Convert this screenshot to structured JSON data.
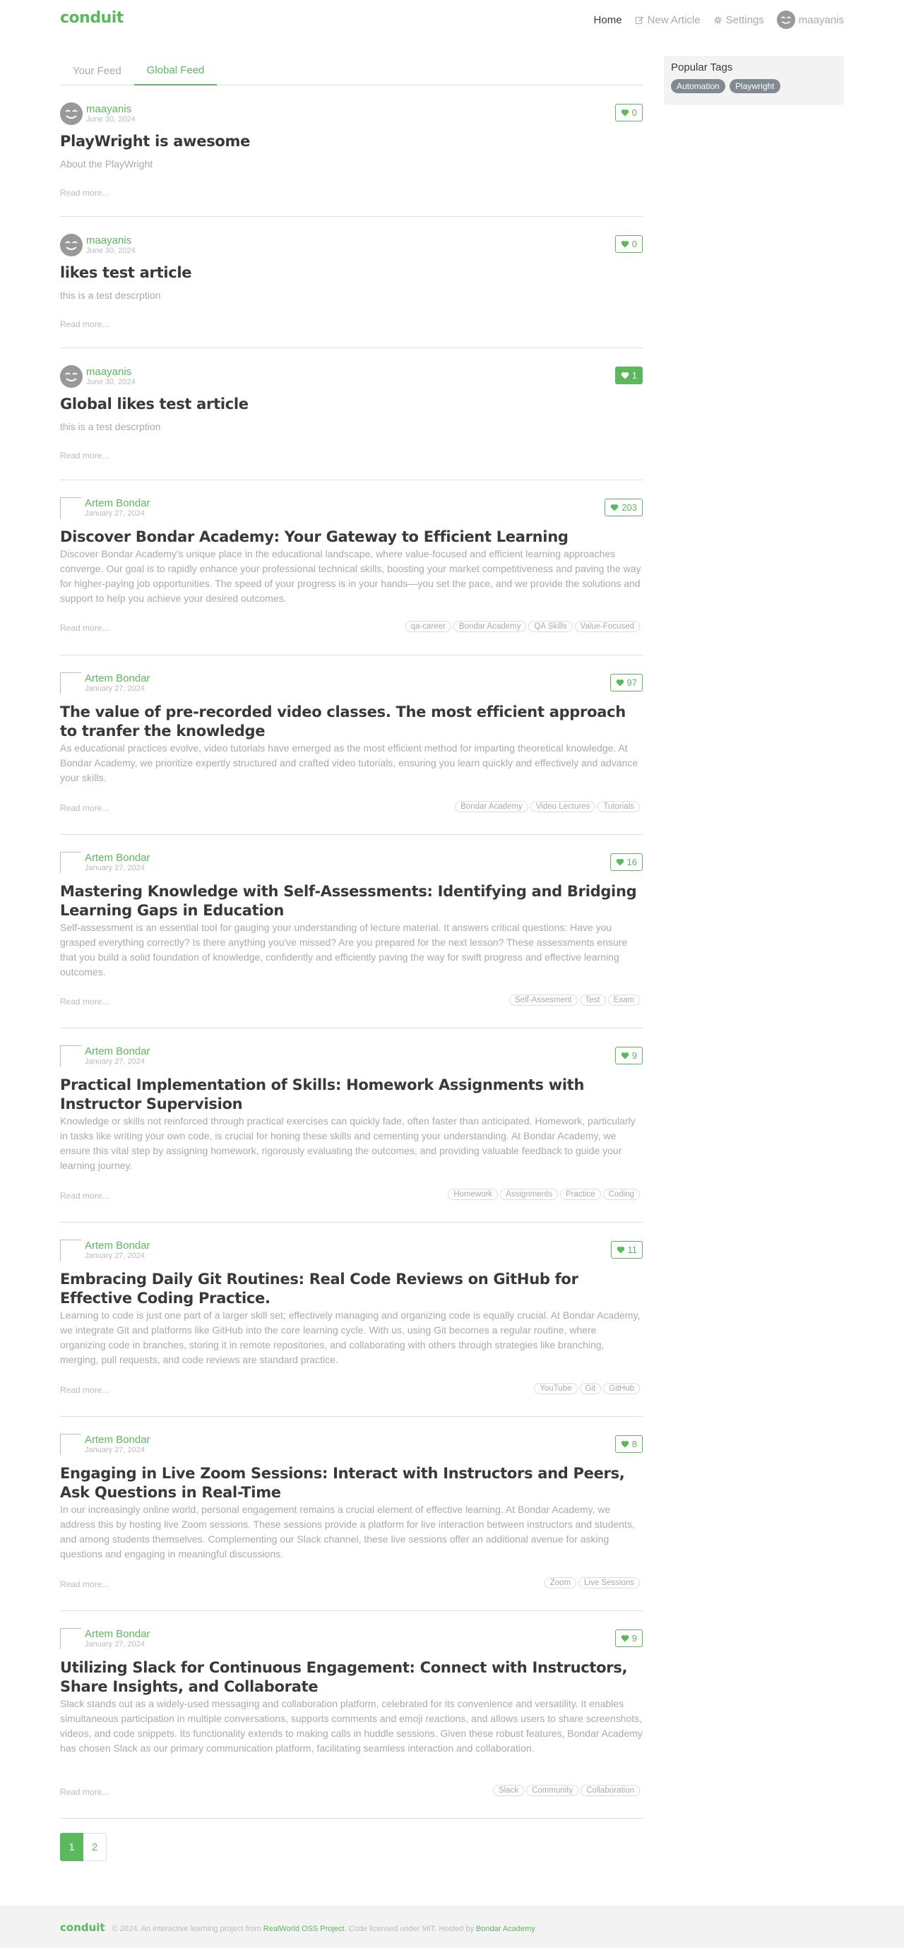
{
  "nav": {
    "brand": "conduit",
    "home": "Home",
    "new_article": "New Article",
    "settings": "Settings",
    "username": "maayanis"
  },
  "tabs": {
    "your_feed": "Your Feed",
    "global_feed": "Global Feed"
  },
  "sidebar": {
    "title": "Popular Tags",
    "tags": [
      "Automation",
      "Playwright"
    ]
  },
  "read_more": "Read more...",
  "articles": [
    {
      "author": "maayanis",
      "date": "June 30, 2024",
      "likes": "0",
      "liked": false,
      "avatar": "smiley",
      "title": "PlayWright is awesome",
      "desc": "About the PlayWright",
      "tags": []
    },
    {
      "author": "maayanis",
      "date": "June 30, 2024",
      "likes": "0",
      "liked": false,
      "avatar": "smiley",
      "title": "likes test article",
      "desc": "this is a test descrption",
      "tags": []
    },
    {
      "author": "maayanis",
      "date": "June 30, 2024",
      "likes": "1",
      "liked": true,
      "avatar": "smiley",
      "title": "Global likes test article",
      "desc": "this is a test descrption",
      "tags": []
    },
    {
      "author": "Artem Bondar",
      "date": "January 27, 2024",
      "likes": "203",
      "liked": false,
      "avatar": "broken",
      "title": "Discover Bondar Academy: Your Gateway to Efficient Learning",
      "desc": "Discover Bondar Academy's unique place in the educational landscape, where value-focused and efficient learning approaches converge. Our goal is to rapidly enhance your professional technical skills, boosting your market competitiveness and paving the way for higher-paying job opportunities. The speed of your progress is in your hands—you set the pace, and we provide the solutions and support to help you achieve your desired outcomes.",
      "tags": [
        "qa-career",
        "Bondar Academy",
        "QA Skills",
        "Value-Focused"
      ]
    },
    {
      "author": "Artem Bondar",
      "date": "January 27, 2024",
      "likes": "97",
      "liked": false,
      "avatar": "broken",
      "title": "The value of pre-recorded video classes. The most efficient approach to tranfer the knowledge",
      "desc": "As educational practices evolve, video tutorials have emerged as the most efficient method for imparting theoretical knowledge. At Bondar Academy, we prioritize expertly structured and crafted video tutorials, ensuring you learn quickly and effectively and advance your skills.",
      "tags": [
        "Bondar Academy",
        "Video Lectures",
        "Tutorials"
      ]
    },
    {
      "author": "Artem Bondar",
      "date": "January 27, 2024",
      "likes": "16",
      "liked": false,
      "avatar": "broken",
      "title": "Mastering Knowledge with Self-Assessments: Identifying and Bridging Learning Gaps in Education",
      "desc": "Self-assessment is an essential tool for gauging your understanding of lecture material. It answers critical questions: Have you grasped everything correctly? Is there anything you've missed? Are you prepared for the next lesson? These assessments ensure that you build a solid foundation of knowledge, confidently and efficiently paving the way for swift progress and effective learning outcomes.",
      "tags": [
        "Self-Assesment",
        "Test",
        "Exam"
      ]
    },
    {
      "author": "Artem Bondar",
      "date": "January 27, 2024",
      "likes": "9",
      "liked": false,
      "avatar": "broken",
      "title": "Practical Implementation of Skills: Homework Assignments with Instructor Supervision",
      "desc": "Knowledge or skills not reinforced through practical exercises can quickly fade, often faster than anticipated. Homework, particularly in tasks like writing your own code, is crucial for honing these skills and cementing your understanding. At Bondar Academy, we ensure this vital step by assigning homework, rigorously evaluating the outcomes, and providing valuable feedback to guide your learning journey.",
      "tags": [
        "Homework",
        "Assignments",
        "Practice",
        "Coding"
      ]
    },
    {
      "author": "Artem Bondar",
      "date": "January 27, 2024",
      "likes": "11",
      "liked": false,
      "avatar": "broken",
      "title": "Embracing Daily Git Routines: Real Code Reviews on GitHub for Effective Coding Practice.",
      "desc": "Learning to code is just one part of a larger skill set; effectively managing and organizing code is equally crucial. At Bondar Academy, we integrate Git and platforms like GitHub into the core learning cycle. With us, using Git becomes a regular routine, where organizing code in branches, storing it in remote repositories, and collaborating with others through strategies like branching, merging, pull requests, and code reviews are standard practice.",
      "tags": [
        "YouTube",
        "Git",
        "GitHub"
      ]
    },
    {
      "author": "Artem Bondar",
      "date": "January 27, 2024",
      "likes": "8",
      "liked": false,
      "avatar": "broken",
      "title": "Engaging in Live Zoom Sessions: Interact with Instructors and Peers, Ask Questions in Real-Time",
      "desc": "In our increasingly online world, personal engagement remains a crucial element of effective learning. At Bondar Academy, we address this by hosting live Zoom sessions. These sessions provide a platform for live interaction between instructors and students, and among students themselves. Complementing our Slack channel, these live sessions offer an additional avenue for asking questions and engaging in meaningful discussions.",
      "tags": [
        "Zoom",
        "Live Sessions"
      ]
    },
    {
      "author": "Artem Bondar",
      "date": "January 27, 2024",
      "likes": "9",
      "liked": false,
      "avatar": "broken",
      "title": "Utilizing Slack for Continuous Engagement: Connect with Instructors, Share Insights, and Collaborate",
      "desc": "Slack stands out as a widely-used messaging and collaboration platform, celebrated for its convenience and versatility. It enables simultaneous participation in multiple conversations, supports comments and emoji reactions, and allows users to share screenshots, videos, and code snippets. Its functionality extends to making calls in huddle sessions. Given these robust features, Bondar Academy has chosen Slack as our primary communication platform, facilitating seamless interaction and collaboration.",
      "tags": [
        "Slack",
        "Community",
        "Collaboration"
      ]
    }
  ],
  "pagination": [
    "1",
    "2"
  ],
  "footer": {
    "logo": "conduit",
    "text_prefix": "© 2024. An interactive learning project from",
    "link1": "RealWorld OSS Project",
    "text_middle": ". Code licensed under MIT. Hosted by",
    "link2": "Bondar Academy",
    "text_suffix": "."
  },
  "colors": {
    "accent": "#5cb85c",
    "muted": "#aaaaaa",
    "tag_bg": "#818a91"
  }
}
